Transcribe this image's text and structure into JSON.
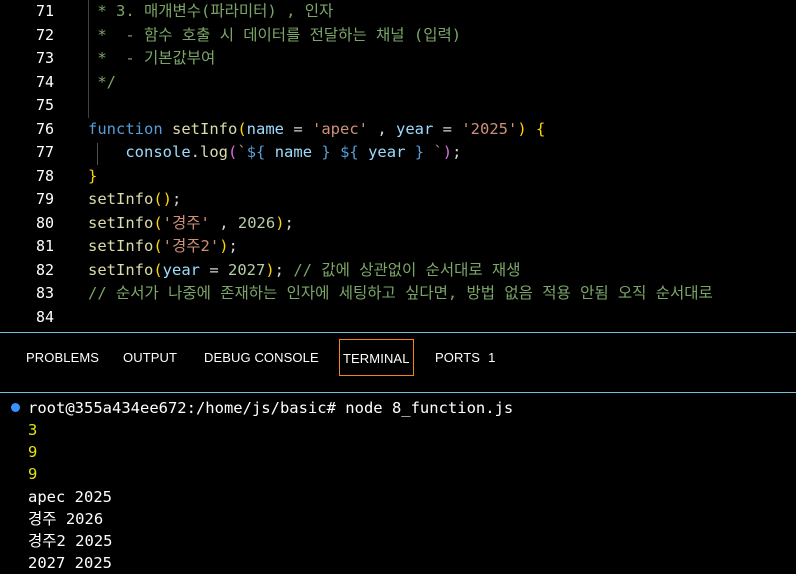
{
  "editor": {
    "lines": [
      {
        "num": "71",
        "tokens": [
          [
            "c-com",
            " * 3. 매개변수(파라미터) , 인자"
          ]
        ]
      },
      {
        "num": "72",
        "tokens": [
          [
            "c-com",
            " *  - 함수 호출 시 데이터를 전달하는 채널 (입력)"
          ]
        ]
      },
      {
        "num": "73",
        "tokens": [
          [
            "c-com",
            " *  - 기본값부여"
          ]
        ]
      },
      {
        "num": "74",
        "tokens": [
          [
            "c-com",
            " */"
          ]
        ]
      },
      {
        "num": "75",
        "tokens": []
      },
      {
        "num": "76",
        "tokens": [
          [
            "c-kw",
            "function"
          ],
          [
            "c-plain",
            " "
          ],
          [
            "c-fn",
            "setInfo"
          ],
          [
            "c-br1",
            "("
          ],
          [
            "c-var",
            "name"
          ],
          [
            "c-op",
            " = "
          ],
          [
            "c-str",
            "'apec'"
          ],
          [
            "c-op",
            " , "
          ],
          [
            "c-var",
            "year"
          ],
          [
            "c-op",
            " = "
          ],
          [
            "c-str",
            "'2025'"
          ],
          [
            "c-br1",
            ")"
          ],
          [
            "c-plain",
            " "
          ],
          [
            "c-br1",
            "{"
          ]
        ]
      },
      {
        "num": "77",
        "tokens": [
          [
            "c-plain",
            "    "
          ],
          [
            "c-var",
            "console"
          ],
          [
            "c-plain",
            "."
          ],
          [
            "c-fn",
            "log"
          ],
          [
            "c-br2",
            "("
          ],
          [
            "c-tpl",
            "`"
          ],
          [
            "c-interp",
            "${"
          ],
          [
            "c-plain",
            " "
          ],
          [
            "c-var",
            "name"
          ],
          [
            "c-plain",
            " "
          ],
          [
            "c-interp",
            "}"
          ],
          [
            "c-plain",
            " "
          ],
          [
            "c-interp",
            "${"
          ],
          [
            "c-plain",
            " "
          ],
          [
            "c-var",
            "year"
          ],
          [
            "c-plain",
            " "
          ],
          [
            "c-interp",
            "}"
          ],
          [
            "c-plain",
            " "
          ],
          [
            "c-tpl",
            "`"
          ],
          [
            "c-br2",
            ")"
          ],
          [
            "c-plain",
            ";"
          ]
        ]
      },
      {
        "num": "78",
        "tokens": [
          [
            "c-br1",
            "}"
          ]
        ]
      },
      {
        "num": "79",
        "tokens": [
          [
            "c-fn",
            "setInfo"
          ],
          [
            "c-br1",
            "()"
          ],
          [
            "c-plain",
            ";"
          ]
        ]
      },
      {
        "num": "80",
        "tokens": [
          [
            "c-fn",
            "setInfo"
          ],
          [
            "c-br1",
            "("
          ],
          [
            "c-str",
            "'경주'"
          ],
          [
            "c-plain",
            " , "
          ],
          [
            "c-num",
            "2026"
          ],
          [
            "c-br1",
            ")"
          ],
          [
            "c-plain",
            ";"
          ]
        ]
      },
      {
        "num": "81",
        "tokens": [
          [
            "c-fn",
            "setInfo"
          ],
          [
            "c-br1",
            "("
          ],
          [
            "c-str",
            "'경주2'"
          ],
          [
            "c-br1",
            ")"
          ],
          [
            "c-plain",
            ";"
          ]
        ]
      },
      {
        "num": "82",
        "tokens": [
          [
            "c-fn",
            "setInfo"
          ],
          [
            "c-br1",
            "("
          ],
          [
            "c-var",
            "year"
          ],
          [
            "c-op",
            " = "
          ],
          [
            "c-num",
            "2027"
          ],
          [
            "c-br1",
            ")"
          ],
          [
            "c-plain",
            "; "
          ],
          [
            "c-com",
            "// 값에 상관없이 순서대로 재생"
          ]
        ]
      },
      {
        "num": "83",
        "tokens": [
          [
            "c-com",
            "// 순서가 나중에 존재하는 인자에 세팅하고 싶다면, 방법 없음 적용 안됨 오직 순서대로"
          ]
        ]
      },
      {
        "num": "84",
        "tokens": []
      }
    ]
  },
  "panel": {
    "tabs": [
      {
        "label": "PROBLEMS",
        "name": "tab-problems"
      },
      {
        "label": "OUTPUT",
        "name": "tab-output"
      },
      {
        "label": "DEBUG CONSOLE",
        "name": "tab-debug-console"
      },
      {
        "label": "TERMINAL",
        "name": "tab-terminal",
        "active": true
      },
      {
        "label": "PORTS",
        "name": "tab-ports",
        "count": "1"
      }
    ]
  },
  "terminal": {
    "prompt": "root@355a434ee672:/home/js/basic# node 8_function.js",
    "output": [
      {
        "text": "3",
        "yellow": true
      },
      {
        "text": "9",
        "yellow": true
      },
      {
        "text": "9",
        "yellow": true
      },
      {
        "text": "apec 2025",
        "yellow": false
      },
      {
        "text": "경주 2026",
        "yellow": false
      },
      {
        "text": "경주2 2025",
        "yellow": false
      },
      {
        "text": "2027 2025",
        "yellow": false
      }
    ]
  },
  "colors": {
    "accent": "#6fc3df",
    "active_tab_border": "#f38518",
    "terminal_dot": "#3794ff"
  }
}
